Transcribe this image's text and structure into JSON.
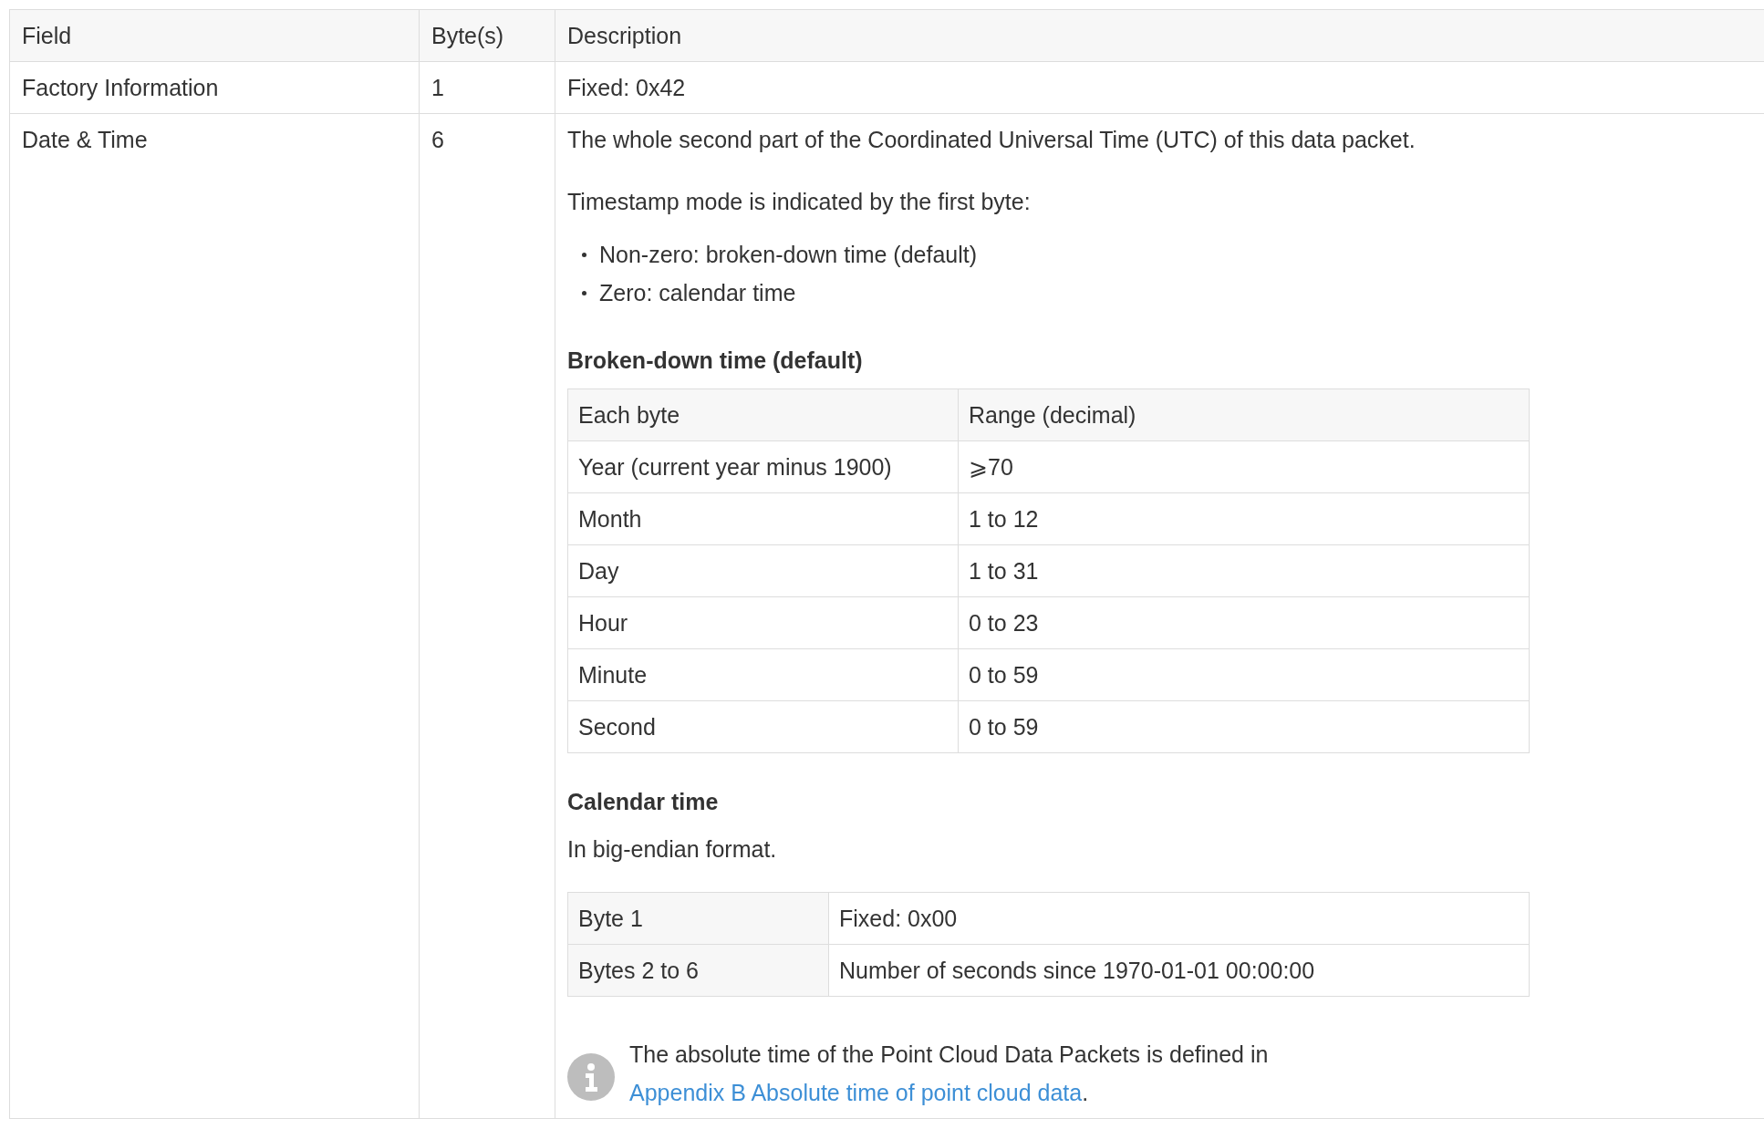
{
  "columns": [
    "Field",
    "Byte(s)",
    "Description"
  ],
  "rows": [
    {
      "field": "Factory Information",
      "bytes": "1",
      "description": [
        {
          "kind": "paragraph",
          "text": "Fixed: 0x42"
        }
      ]
    },
    {
      "field": "Date & Time",
      "bytes": "6",
      "description": [
        {
          "kind": "paragraph",
          "text": "The whole second part of the Coordinated Universal Time (UTC) of this data packet."
        },
        {
          "kind": "paragraph",
          "text": "Timestamp mode is indicated by the first byte:"
        },
        {
          "kind": "list",
          "items": [
            "Non-zero: broken-down time (default)",
            "Zero: calendar time"
          ]
        },
        {
          "kind": "heading",
          "text": "Broken-down time (default)"
        },
        {
          "kind": "table",
          "columns": [
            "Each byte",
            "Range (decimal)"
          ],
          "rows": [
            [
              "Year (current year minus 1900)",
              "⩾70"
            ],
            [
              "Month",
              "1 to 12"
            ],
            [
              "Day",
              "1 to 31"
            ],
            [
              "Hour",
              "0 to 23"
            ],
            [
              "Minute",
              "0 to 59"
            ],
            [
              "Second",
              "0 to 59"
            ]
          ]
        },
        {
          "kind": "heading",
          "text": "Calendar time"
        },
        {
          "kind": "paragraph",
          "text": "In big-endian format."
        },
        {
          "kind": "key_table",
          "rows": [
            [
              "Byte 1",
              "Fixed: 0x00"
            ],
            [
              "Bytes 2 to 6",
              "Number of seconds since 1970-01-01 00:00:00"
            ]
          ]
        },
        {
          "kind": "note",
          "text": "The absolute time of the Point Cloud Data Packets is defined in ",
          "link": "Appendix B Absolute time of point cloud data",
          "after": "."
        }
      ]
    }
  ]
}
